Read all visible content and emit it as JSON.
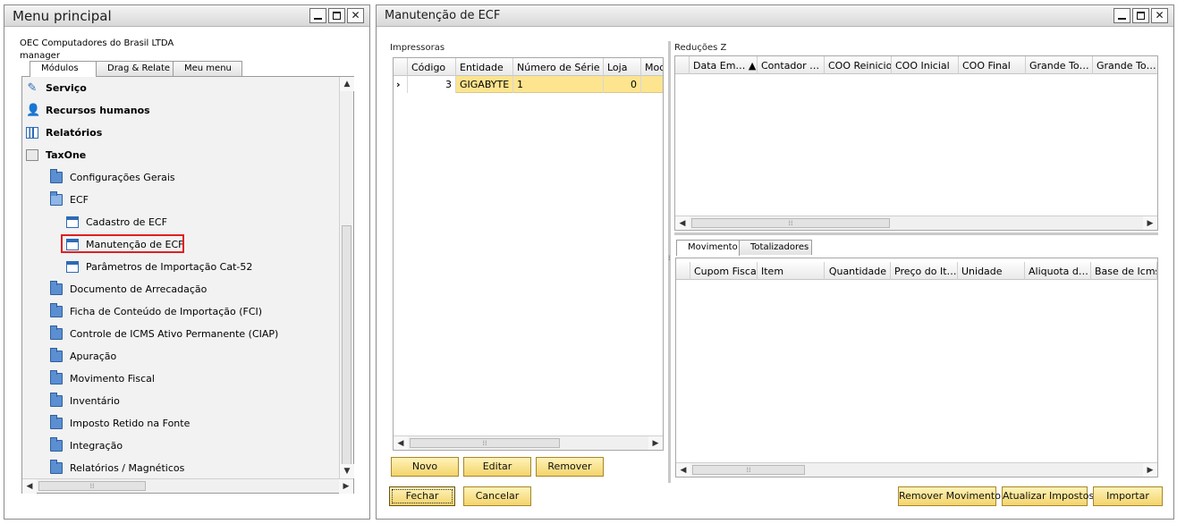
{
  "left_window": {
    "title": "Menu principal",
    "company": "OEC Computadores do Brasil LTDA",
    "user": "manager",
    "tabs": [
      {
        "label": "Módulos"
      },
      {
        "label": "Drag & Relate"
      },
      {
        "label": "Meu menu"
      }
    ],
    "menu_items": [
      {
        "label": "Serviço",
        "icon": "service-icon"
      },
      {
        "label": "Recursos humanos",
        "icon": "people-icon"
      },
      {
        "label": "Relatórios",
        "icon": "reports-icon"
      },
      {
        "label": "TaxOne",
        "icon": "module-icon"
      },
      {
        "label": "Configurações Gerais",
        "icon": "folder-icon"
      },
      {
        "label": "ECF",
        "icon": "folder-open-icon"
      },
      {
        "label": "Cadastro de ECF",
        "icon": "form-icon"
      },
      {
        "label": "Manutenção de ECF",
        "icon": "form-icon",
        "highlighted": true
      },
      {
        "label": "Parâmetros de Importação Cat-52",
        "icon": "form-icon"
      },
      {
        "label": "Documento de Arrecadação",
        "icon": "folder-icon"
      },
      {
        "label": "Ficha de Conteúdo de Importação (FCI)",
        "icon": "folder-icon"
      },
      {
        "label": "Controle de ICMS Ativo Permanente (CIAP)",
        "icon": "folder-icon"
      },
      {
        "label": "Apuração",
        "icon": "folder-icon"
      },
      {
        "label": "Movimento Fiscal",
        "icon": "folder-icon"
      },
      {
        "label": "Inventário",
        "icon": "folder-icon"
      },
      {
        "label": "Imposto Retido na Fonte",
        "icon": "folder-icon"
      },
      {
        "label": "Integração",
        "icon": "folder-icon"
      },
      {
        "label": "Relatórios / Magnéticos",
        "icon": "folder-icon"
      }
    ]
  },
  "right_window": {
    "title": "Manutenção de ECF",
    "printers": {
      "label": "Impressoras",
      "columns": [
        "Código",
        "Entidade",
        "Número de Série",
        "Loja",
        "Mod"
      ],
      "rows": [
        {
          "codigo": "3",
          "entidade": "GIGABYTE",
          "numero_serie": "1",
          "loja": "0",
          "mod": ""
        }
      ]
    },
    "reducoes": {
      "label": "Reduções Z",
      "columns": [
        "Data Em…  ▲",
        "Contador …",
        "COO Reinicio",
        "COO Inicial",
        "COO Final",
        "Grande To…",
        "Grande To…"
      ]
    },
    "detail_tabs": [
      {
        "label": "Movimento"
      },
      {
        "label": "Totalizadores"
      }
    ],
    "movimento": {
      "columns": [
        "Cupom Fiscal",
        "Item",
        "Quantidade",
        "Preço do It…",
        "Unidade",
        "Aliquota d…",
        "Base de Icms"
      ]
    },
    "buttons": {
      "novo": "Novo",
      "editar": "Editar",
      "remover": "Remover",
      "fechar": "Fechar",
      "cancelar": "Cancelar",
      "remover_movimento": "Remover Movimento",
      "atualizar_impostos": "Atualizar Impostos",
      "importar": "Importar"
    }
  },
  "window_controls": {
    "minimize": "minimize-icon",
    "maximize": "maximize-icon",
    "close": "close-icon",
    "close_glyph": "✕"
  },
  "colors": {
    "selected_row": "#fde48f",
    "button": "#f3d46c",
    "highlight_border": "#e02020",
    "folder": "#5b8fd1"
  }
}
